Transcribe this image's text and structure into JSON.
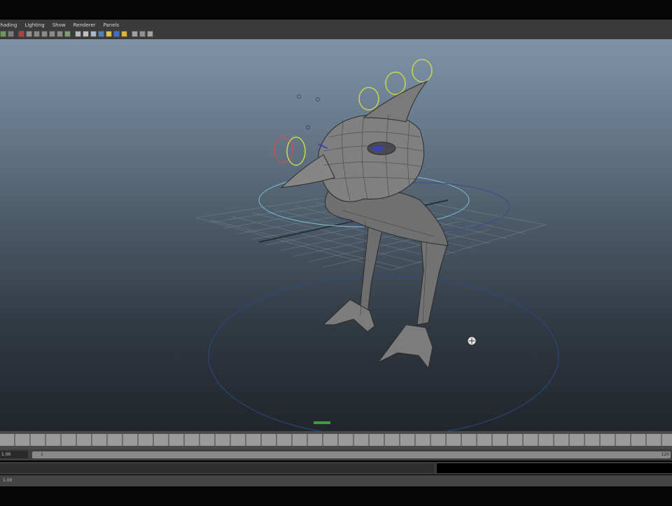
{
  "menu": [
    "Shading",
    "Lighting",
    "Show",
    "Renderer",
    "Panels"
  ],
  "toolbar": {
    "icons": [
      {
        "name": "camera-select-icon",
        "color": "#6a9a5a"
      },
      {
        "name": "camera-attributes-icon",
        "color": "#7a7a7a"
      },
      {
        "name": "image-plane-icon",
        "color": "#b04040"
      },
      {
        "name": "grid-toggle-icon",
        "color": "#909090"
      },
      {
        "name": "film-gate-icon",
        "color": "#8a8a8a"
      },
      {
        "name": "resolution-gate-icon",
        "color": "#8a8a8a"
      },
      {
        "name": "gate-mask-icon",
        "color": "#8a8a8a"
      },
      {
        "name": "field-chart-icon",
        "color": "#8a8a8a"
      },
      {
        "name": "safe-action-icon",
        "color": "#7aa070"
      },
      {
        "name": "wireframe-icon",
        "color": "#b8b8b8"
      },
      {
        "name": "smooth-shade-icon",
        "color": "#c0c0c0"
      },
      {
        "name": "shade-wireframe-icon",
        "color": "#a8b8c8"
      },
      {
        "name": "textured-icon",
        "color": "#4a80c0"
      },
      {
        "name": "use-all-lights-icon",
        "color": "#e0c040"
      },
      {
        "name": "shadows-icon",
        "color": "#3a70d0"
      },
      {
        "name": "screen-space-ao-icon",
        "color": "#e0b030"
      },
      {
        "name": "isolate-select-icon",
        "color": "#a0a0a0"
      },
      {
        "name": "xray-icon",
        "color": "#909090"
      },
      {
        "name": "xray-joints-icon",
        "color": "#a0a0a0"
      }
    ]
  },
  "timeline": {
    "range_start": "1.00",
    "slider_start": "1",
    "slider_end": "120"
  },
  "help_line": "1.00"
}
